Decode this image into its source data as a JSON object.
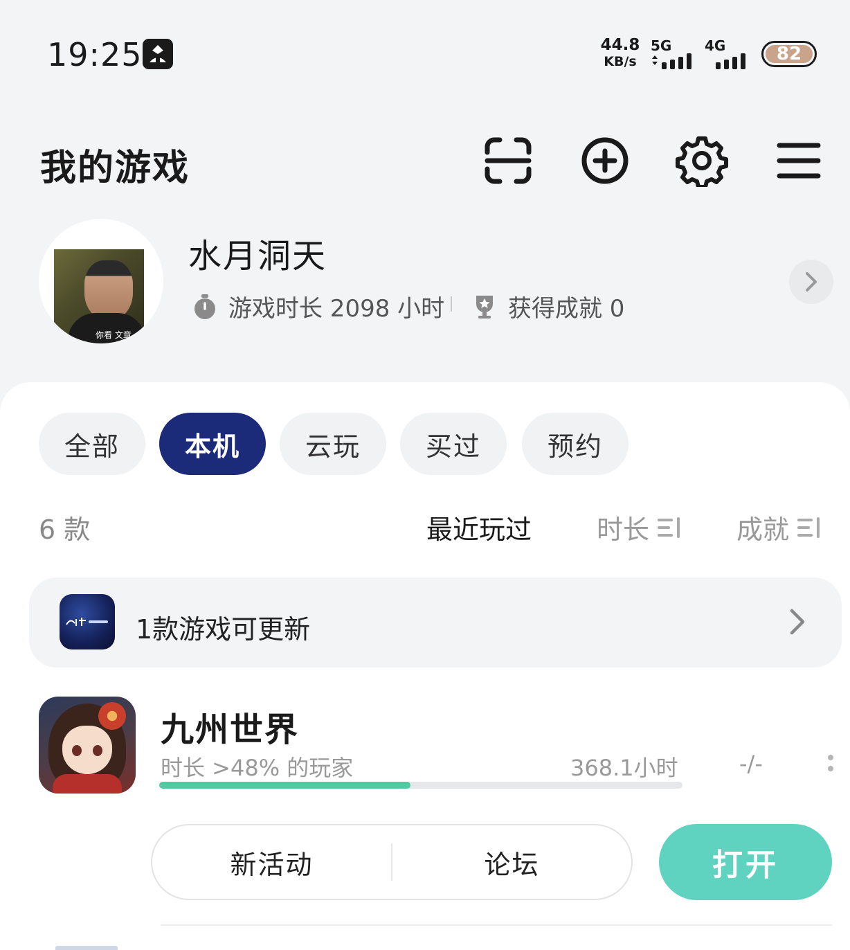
{
  "status_bar": {
    "time": "19:25",
    "net_speed_value": "44.8",
    "net_speed_unit": "KB/s",
    "sim1_label": "5G",
    "sim2_label": "4G",
    "battery": "82"
  },
  "header": {
    "title": "我的游戏",
    "icons": [
      "scan-icon",
      "add-circle-icon",
      "gear-icon",
      "menu-icon"
    ]
  },
  "profile": {
    "name": "水月洞天",
    "avatar_caption": "你看 文章",
    "playtime_label": "游戏时长 2098 小时",
    "achievements_label": "获得成就 0"
  },
  "filters": {
    "tabs": [
      "全部",
      "本机",
      "云玩",
      "买过",
      "预约"
    ],
    "active_index": 1
  },
  "sort_bar": {
    "count": "6 款",
    "options": [
      "最近玩过",
      "时长",
      "成就"
    ],
    "active": "最近玩过"
  },
  "update_banner": {
    "text": "1款游戏可更新"
  },
  "game": {
    "title": "九州世界",
    "subtitle": "时长 >48% 的玩家",
    "hours": "368.1小时",
    "achievements": "-/-",
    "progress": 0.48,
    "actions": [
      "新活动",
      "论坛"
    ],
    "open_label": "打开"
  },
  "colors": {
    "accent_navy": "#1c2a7a",
    "open_button": "#5fd3bf",
    "progress": "#52c9a0",
    "battery": "#c9a48a"
  }
}
